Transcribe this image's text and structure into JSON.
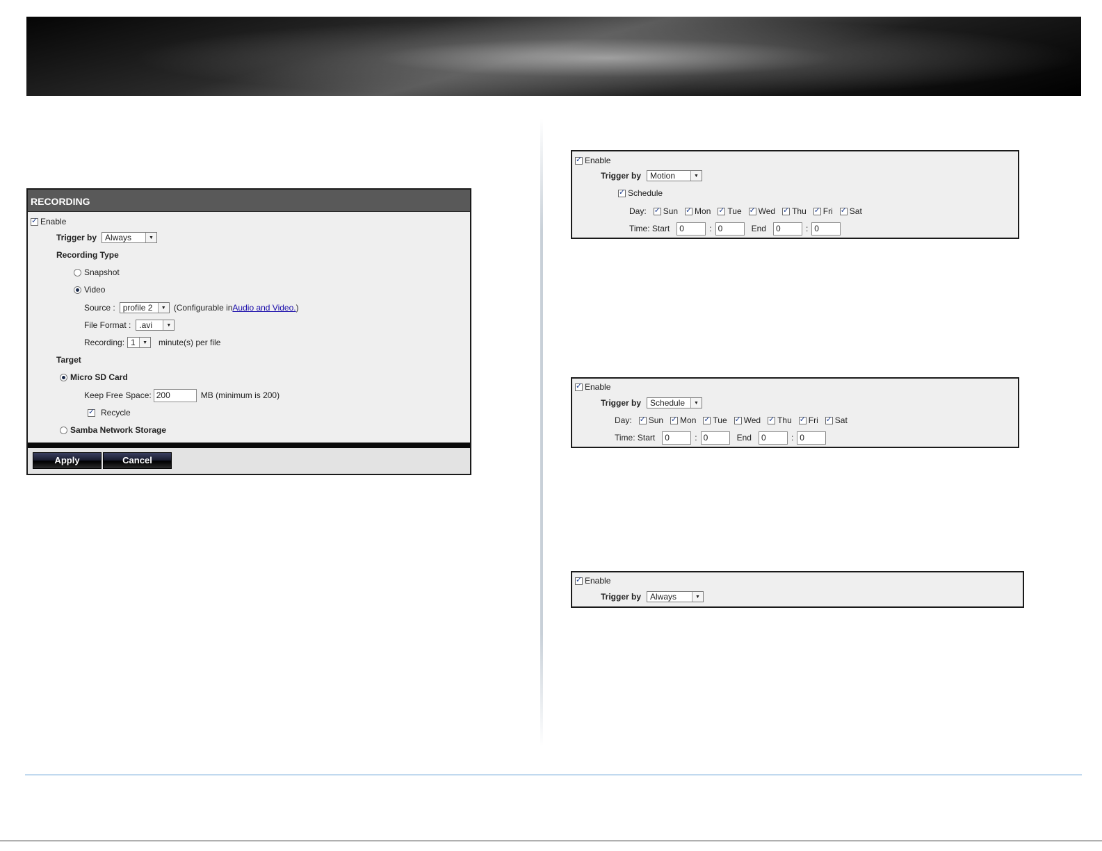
{
  "main_panel": {
    "title": "RECORDING",
    "enable_label": "Enable",
    "trigger_label": "Trigger by",
    "trigger_value": "Always",
    "recording_type_label": "Recording Type",
    "snapshot_label": "Snapshot",
    "video_label": "Video",
    "source_label": "Source :",
    "source_value": "profile 2",
    "configurable_prefix": "(Configurable in ",
    "configurable_link": "Audio and Video.",
    "configurable_suffix": ")",
    "file_format_label": "File Format :",
    "file_format_value": ".avi",
    "recording_label": "Recording:",
    "recording_value": "1",
    "recording_suffix": "minute(s) per file",
    "target_label": "Target",
    "micro_sd_label": "Micro SD Card",
    "keep_free_label": "Keep Free Space:",
    "keep_free_value": "200",
    "keep_free_suffix": "MB (minimum is 200)",
    "recycle_label": "Recycle",
    "samba_label": "Samba Network Storage",
    "apply_label": "Apply",
    "cancel_label": "Cancel"
  },
  "motion_panel": {
    "enable_label": "Enable",
    "trigger_label": "Trigger by",
    "trigger_value": "Motion",
    "schedule_label": "Schedule",
    "day_label": "Day:",
    "days": [
      "Sun",
      "Mon",
      "Tue",
      "Wed",
      "Thu",
      "Fri",
      "Sat"
    ],
    "time_start_label": "Time: Start",
    "start_hour": "0",
    "start_min": "0",
    "colon": ":",
    "end_label": "End",
    "end_hour": "0",
    "end_min": "0"
  },
  "schedule_panel": {
    "enable_label": "Enable",
    "trigger_label": "Trigger by",
    "trigger_value": "Schedule",
    "day_label": "Day:",
    "days": [
      "Sun",
      "Mon",
      "Tue",
      "Wed",
      "Thu",
      "Fri",
      "Sat"
    ],
    "time_start_label": "Time: Start",
    "start_hour": "0",
    "start_min": "0",
    "colon": ":",
    "end_label": "End",
    "end_hour": "0",
    "end_min": "0"
  },
  "always_panel": {
    "enable_label": "Enable",
    "trigger_label": "Trigger by",
    "trigger_value": "Always"
  },
  "colors": {
    "panel_bg": "#efefef",
    "title_bar": "#595959",
    "link": "#1a0dab",
    "footer_rule": "#5b9bd5"
  }
}
